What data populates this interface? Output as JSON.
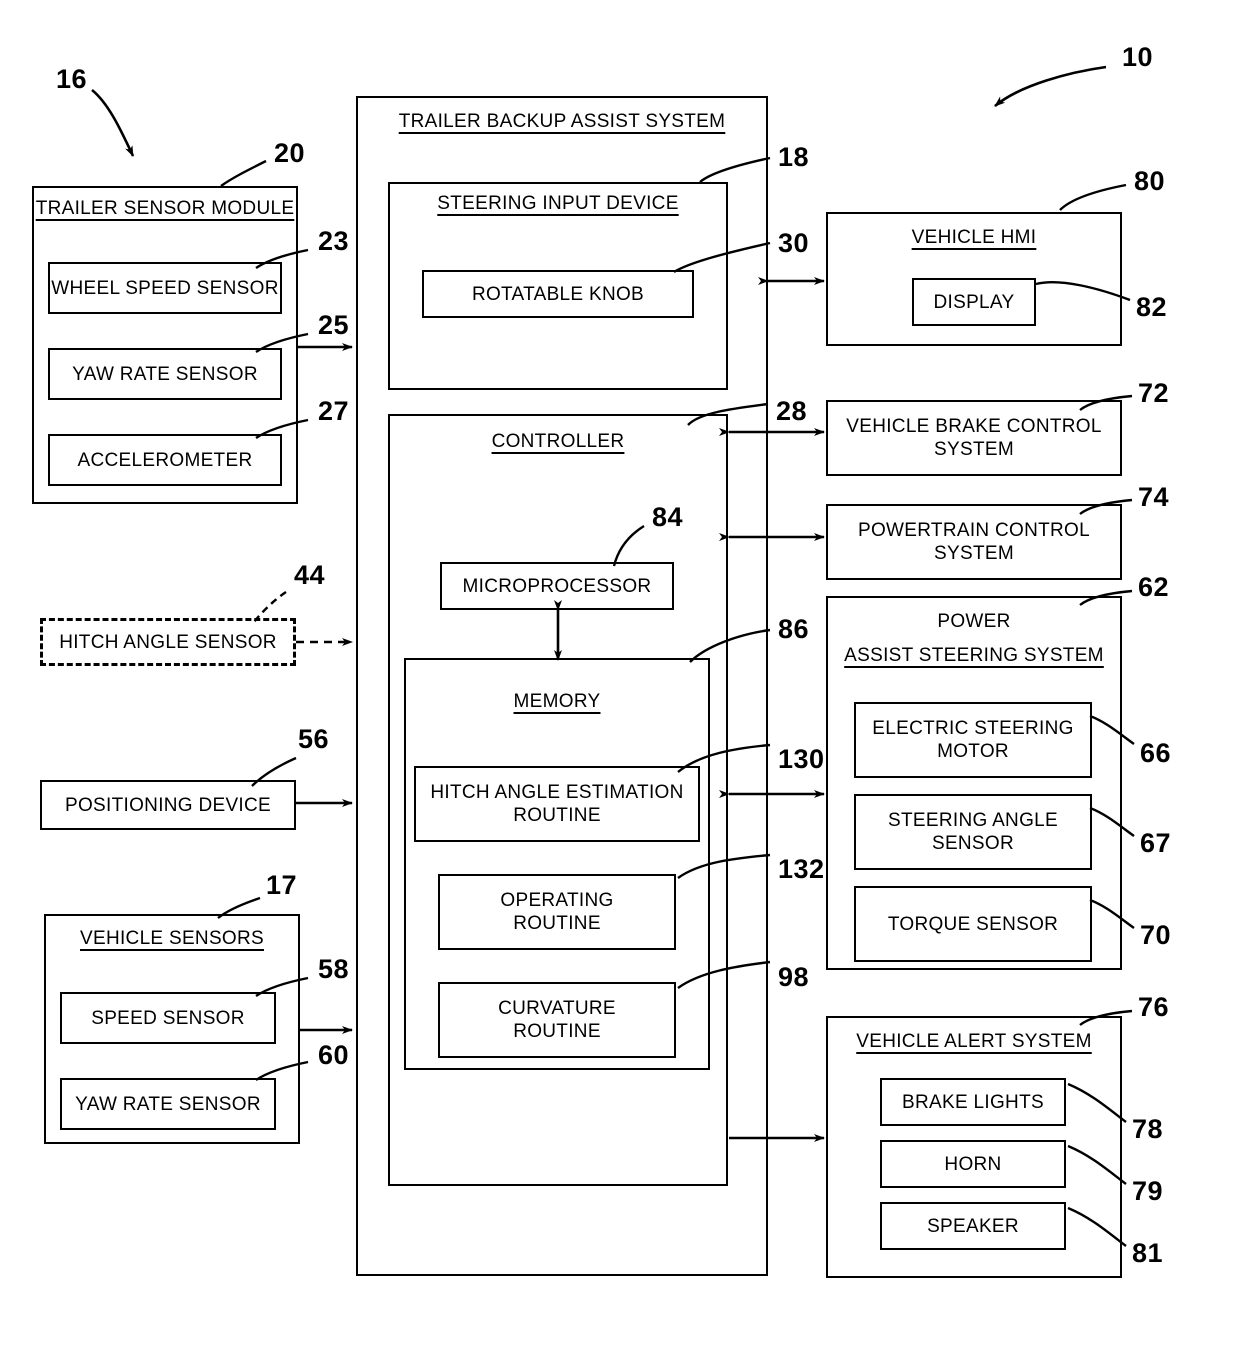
{
  "figure": {
    "main_ref": "10",
    "trailer_ref": "16"
  },
  "main_system": {
    "title": "TRAILER BACKUP ASSIST SYSTEM",
    "steering_input_device": {
      "title": "STEERING INPUT DEVICE",
      "ref": "18",
      "rotatable_knob": {
        "label": "ROTATABLE KNOB",
        "ref": "30"
      }
    },
    "controller": {
      "title": "CONTROLLER",
      "ref": "28",
      "microprocessor": {
        "label": "MICROPROCESSOR",
        "ref": "84"
      },
      "memory": {
        "title": "MEMORY",
        "ref": "86",
        "routines": [
          {
            "line1": "HITCH ANGLE ESTIMATION",
            "line2": "ROUTINE",
            "ref": "130"
          },
          {
            "line1": "OPERATING",
            "line2": "ROUTINE",
            "ref": "132"
          },
          {
            "line1": "CURVATURE",
            "line2": "ROUTINE",
            "ref": "98"
          }
        ]
      }
    }
  },
  "left_column": {
    "trailer_sensor_module": {
      "title": "TRAILER SENSOR MODULE",
      "ref": "20",
      "sensors": [
        {
          "label": "WHEEL SPEED SENSOR",
          "ref": "23"
        },
        {
          "label": "YAW RATE SENSOR",
          "ref": "25"
        },
        {
          "label": "ACCELEROMETER",
          "ref": "27"
        }
      ]
    },
    "hitch_angle_sensor": {
      "label": "HITCH ANGLE SENSOR",
      "ref": "44"
    },
    "positioning_device": {
      "label": "POSITIONING DEVICE",
      "ref": "56"
    },
    "vehicle_sensors": {
      "title": "VEHICLE SENSORS",
      "ref": "17",
      "sensors": [
        {
          "label": "SPEED SENSOR",
          "ref": "58"
        },
        {
          "label": "YAW RATE SENSOR",
          "ref": "60"
        }
      ]
    }
  },
  "right_column": {
    "vehicle_hmi": {
      "title": "VEHICLE HMI",
      "ref": "80",
      "display": {
        "label": "DISPLAY",
        "ref": "82"
      }
    },
    "vehicle_brake_control_system": {
      "line1": "VEHICLE BRAKE CONTROL",
      "line2": "SYSTEM",
      "ref": "72"
    },
    "powertrain_control_system": {
      "line1": "POWERTRAIN CONTROL",
      "line2": "SYSTEM",
      "ref": "74"
    },
    "power_assist_steering_system": {
      "line1": "POWER",
      "line2": "ASSIST STEERING SYSTEM",
      "ref": "62",
      "components": [
        {
          "line1": "ELECTRIC STEERING",
          "line2": "MOTOR",
          "ref": "66"
        },
        {
          "line1": "STEERING ANGLE",
          "line2": "SENSOR",
          "ref": "67"
        },
        {
          "line1": "TORQUE SENSOR",
          "line2": "",
          "ref": "70"
        }
      ]
    },
    "vehicle_alert_system": {
      "title": "VEHICLE ALERT SYSTEM",
      "ref": "76",
      "components": [
        {
          "label": "BRAKE LIGHTS",
          "ref": "78"
        },
        {
          "label": "HORN",
          "ref": "79"
        },
        {
          "label": "SPEAKER",
          "ref": "81"
        }
      ]
    }
  }
}
